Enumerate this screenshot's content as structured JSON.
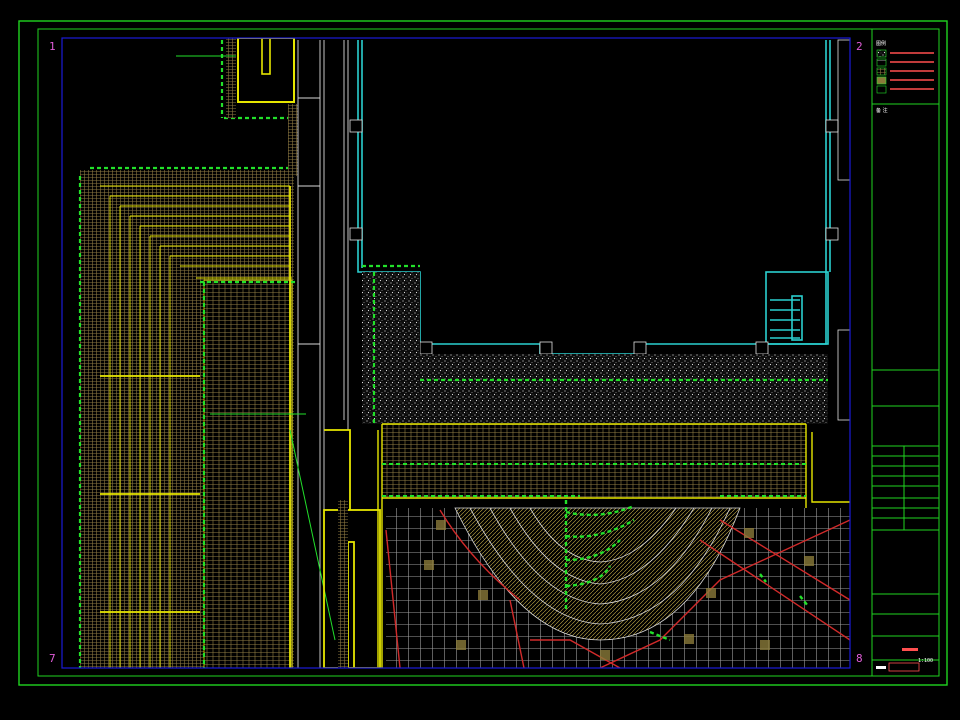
{
  "drawing": {
    "corner_marks": {
      "top_left": "1",
      "top_right": "2",
      "bottom_left": "7",
      "bottom_right": "8"
    },
    "colors": {
      "frame": "#1fd41f",
      "viewport": "#1b1bd8",
      "wall": "#e6e600",
      "building": "#2ad0d0",
      "hedge": "#22e02a",
      "paving": "#7a6a3a",
      "road": "#d12a2a",
      "grid": "#bdbdbd",
      "note": "#ff4f4f",
      "corner": "#e05cd8"
    }
  },
  "title_block": {
    "legend_header": "图例",
    "legend_items": [
      "",
      "",
      "",
      "",
      ""
    ],
    "notes_header": "备 注",
    "sheet_name": "",
    "scale": "1:100",
    "drawing_no": "",
    "stamp_rows": [
      "",
      "",
      "",
      "",
      "",
      ""
    ]
  }
}
